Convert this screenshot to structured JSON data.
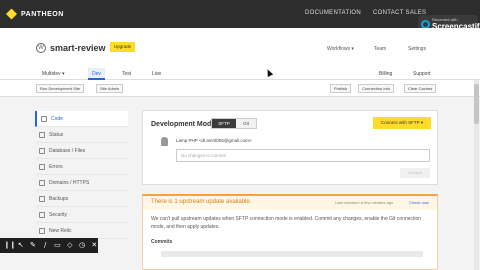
{
  "topbar": {
    "logo_text": "PANTHEON",
    "documentation": "DOCUMENTATION",
    "contact_sales": "CONTACT SALES"
  },
  "watermark": {
    "small": "Recorded with",
    "big": "Screencastify"
  },
  "site": {
    "name": "smart-review",
    "upgrade_label": "Upgrade",
    "workflows": "Workflows ▾",
    "team": "Team",
    "settings": "Settings"
  },
  "env_tabs": {
    "multidev": "Multidev ▾",
    "dev": "Dev",
    "test": "Test",
    "live": "Live",
    "billing": "Billing",
    "support": "Support"
  },
  "toolbar": {
    "run_dev_site": "Run Development Site",
    "site_admin": "Site Admin",
    "visit": "Publish",
    "connection_info": "Connection Info",
    "clear_caches": "Clear Caches"
  },
  "sidebar": {
    "items": [
      {
        "label": "Code",
        "icon": "code-icon"
      },
      {
        "label": "Status",
        "icon": "status-icon"
      },
      {
        "label": "Database / Files",
        "icon": "database-icon"
      },
      {
        "label": "Errors",
        "icon": "errors-icon"
      },
      {
        "label": "Domains / HTTPS",
        "icon": "domains-icon"
      },
      {
        "label": "Backups",
        "icon": "backups-icon"
      },
      {
        "label": "Security",
        "icon": "security-icon"
      },
      {
        "label": "New Relic",
        "icon": "new-relic-icon"
      }
    ]
  },
  "code_panel": {
    "title": "Development Mode",
    "sftp_label": "SFTP",
    "git_label": "Git",
    "connect_label": "Connect with SFTP ▾",
    "user_line": "Lamp PHP <dl.amrit005@gmail.com>",
    "message_placeholder": "No changes to commit",
    "commit_label": "Commit"
  },
  "notice": {
    "title": "There is 1 upstream update available.",
    "meta": "Last checked: a few minutes ago",
    "check_now": "Check now",
    "body": "We can't pull upstream updates when SFTP connection mode is enabled. Commit any changes, enable the Git connection mode, and then apply updates.",
    "commits_heading": "Commits"
  },
  "annotation_tools": [
    "pause-icon",
    "pointer-icon",
    "pen-icon",
    "highlighter-icon",
    "rectangle-icon",
    "erase-icon",
    "timer-icon",
    "close-icon"
  ],
  "annotation_glyphs": [
    "❙❙",
    "↖",
    "✎",
    "/",
    "▭",
    "◇",
    "◷",
    "✕"
  ],
  "colors": {
    "accent": "#2563eb",
    "brand_yellow": "#ffdc28",
    "warning": "#f0a24b"
  }
}
